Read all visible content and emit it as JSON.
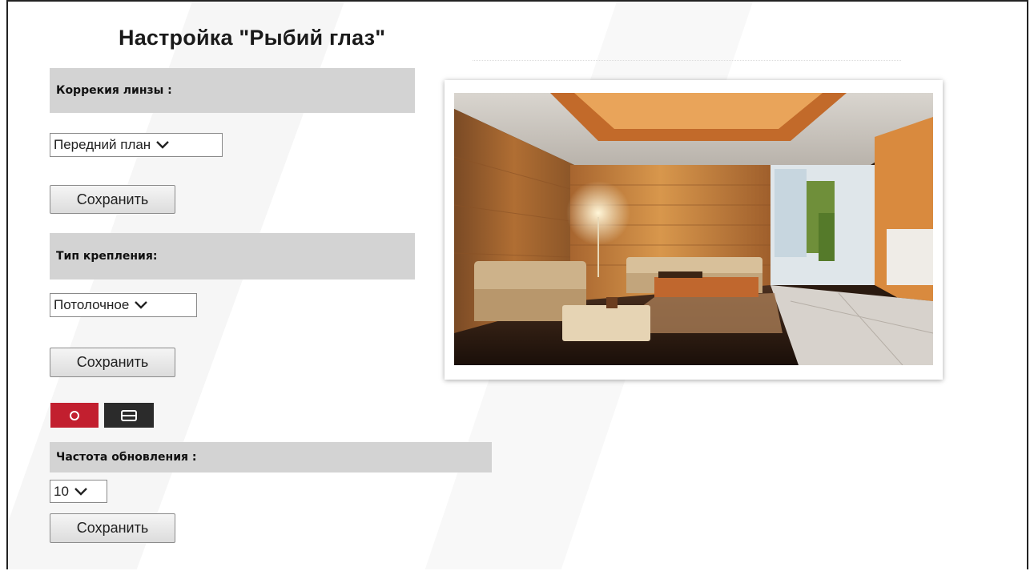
{
  "page": {
    "title": "Настройка \"Рыбий глаз\""
  },
  "lens_correction": {
    "label": "Коррекия линзы :",
    "value": "Передний план",
    "save_label": "Сохранить"
  },
  "mount_type": {
    "label": "Тип крепления:",
    "value": "Потолочное",
    "save_label": "Сохранить"
  },
  "view_modes": {
    "circle_icon": "circle-icon",
    "panel_icon": "panorama-icon",
    "active_color": "#c21f2f",
    "inactive_color": "#2b2b2b"
  },
  "refresh_rate": {
    "label": "Частота обновления :",
    "value": "10",
    "save_label": "Сохранить"
  }
}
